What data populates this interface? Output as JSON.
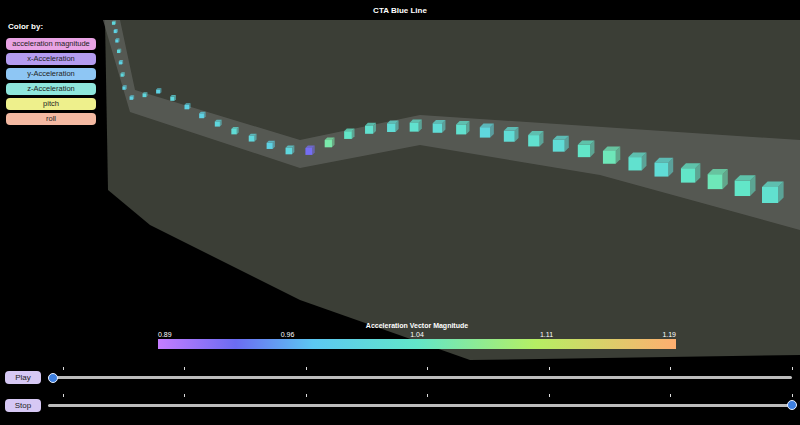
{
  "title": "CTA Blue Line",
  "color_by": {
    "label": "Color by:",
    "options": [
      {
        "label": "acceleration magnitude",
        "color": "#e9a3e4"
      },
      {
        "label": "x-Acceleration",
        "color": "#b49cf0"
      },
      {
        "label": "y-Acceleration",
        "color": "#8ec6f4"
      },
      {
        "label": "z-Acceleration",
        "color": "#8ee6dc"
      },
      {
        "label": "pitch",
        "color": "#eef08c"
      },
      {
        "label": "roll",
        "color": "#f4b9a2"
      }
    ]
  },
  "map": {
    "track": {
      "values": [
        1.0,
        1.01,
        1.0,
        1.01,
        1.0,
        1.0,
        1.01,
        1.0,
        1.01,
        1.0,
        1.0,
        1.01,
        1.0,
        1.01,
        1.0,
        1.0,
        1.01,
        1.02,
        1.01,
        1.0,
        1.01,
        0.93,
        1.06,
        1.04,
        1.03,
        1.02,
        1.03,
        1.02,
        1.03,
        1.01,
        1.02,
        1.03,
        1.02,
        1.04,
        1.05,
        1.03,
        1.02,
        1.04,
        1.05,
        1.04,
        1.03
      ]
    }
  },
  "colorbar": {
    "title": "Acceleration Vector Magnitude",
    "ticks": [
      "0.89",
      "0.96",
      "1.04",
      "1.11",
      "1.19"
    ]
  },
  "sliders": [
    {
      "button": "Play",
      "level": 0
    },
    {
      "button": "Stop",
      "level": 1
    }
  ]
}
